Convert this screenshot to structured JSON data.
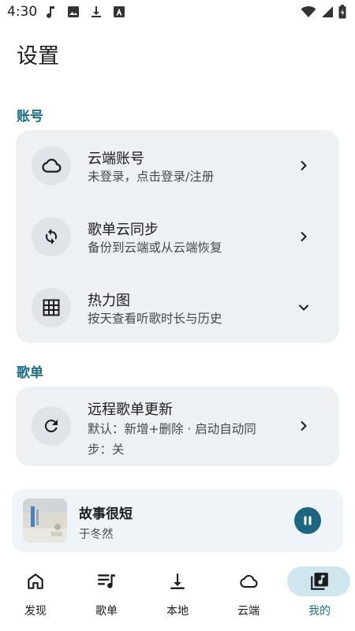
{
  "status_bar": {
    "time": "4:30",
    "left_icons": [
      "music-note-icon",
      "image-icon",
      "download-icon",
      "font-icon"
    ],
    "right_icons": [
      "wifi-icon",
      "signal-icon",
      "battery-icon"
    ]
  },
  "page": {
    "title": "设置"
  },
  "sections": {
    "account": {
      "label": "账号",
      "rows": [
        {
          "title": "云端账号",
          "subtitle": "未登录，点击登录/注册",
          "icon": "cloud-icon",
          "trailing": "chevron-right-icon"
        },
        {
          "title": "歌单云同步",
          "subtitle": "备份到云端或从云端恢复",
          "icon": "sync-icon",
          "trailing": "chevron-right-icon"
        },
        {
          "title": "热力图",
          "subtitle": "按天查看听歌时长与历史",
          "icon": "grid-icon",
          "trailing": "chevron-down-icon"
        }
      ]
    },
    "playlist": {
      "label": "歌单",
      "rows": [
        {
          "title": "远程歌单更新",
          "subtitle_line1": "默认：新增+删除 · 启动自动同",
          "subtitle_line2": "步：关",
          "icon": "refresh-icon",
          "trailing": "chevron-right-icon"
        }
      ]
    }
  },
  "mini_player": {
    "title": "故事很短",
    "artist": "于冬然",
    "state": "playing"
  },
  "bottom_nav": {
    "active": "我的",
    "items": [
      {
        "label": "发现",
        "icon": "home-icon"
      },
      {
        "label": "歌单",
        "icon": "playlist-icon"
      },
      {
        "label": "本地",
        "icon": "download-icon"
      },
      {
        "label": "云端",
        "icon": "cloud-icon"
      },
      {
        "label": "我的",
        "icon": "library-music-icon"
      }
    ]
  },
  "colors": {
    "accent": "#1d6e86",
    "card_bg": "#eef1f4",
    "nav_active_pill": "#cfe6ef",
    "play_button": "#1d6580"
  }
}
